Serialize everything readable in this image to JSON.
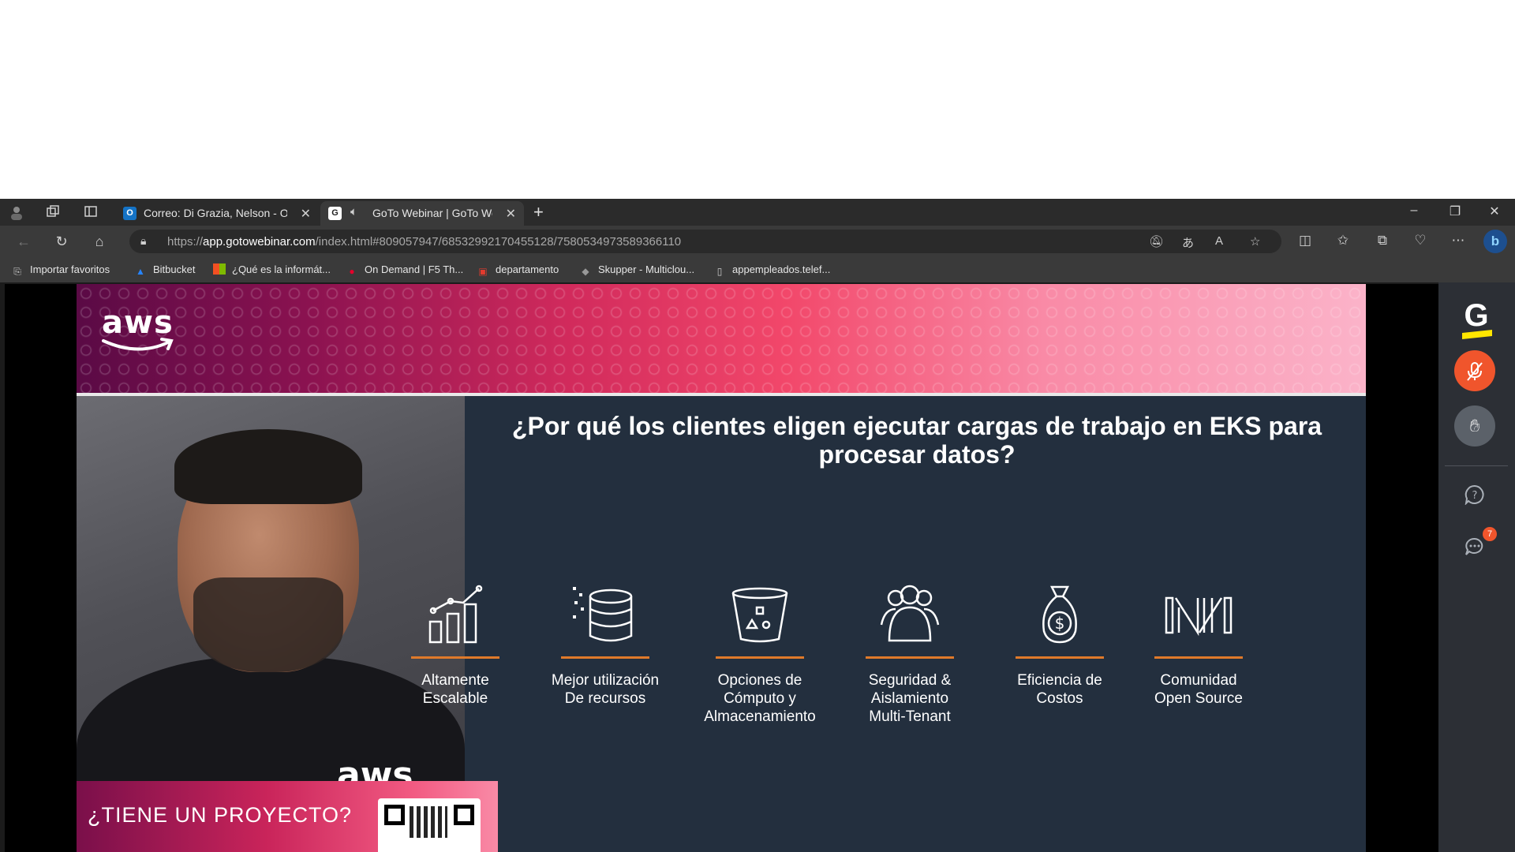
{
  "browser": {
    "tabs": [
      {
        "title": "Correo: Di Grazia, Nelson - Outlook",
        "favicon": "outlook-icon"
      },
      {
        "title": "GoTo Webinar | GoTo Webinar",
        "favicon": "goto-icon",
        "active": true,
        "audio": true
      }
    ],
    "url": {
      "scheme": "https://",
      "host": "app.gotowebinar.com",
      "path": "/index.html#809057947/6853299217045512­8/7580534973589366110"
    },
    "bookmarks": [
      {
        "label": "Importar favoritos",
        "icon": "import-icon"
      },
      {
        "label": "Bitbucket",
        "icon": "bitbucket-icon"
      },
      {
        "label": "¿Qué es la informát...",
        "icon": "microsoft-icon"
      },
      {
        "label": "On Demand | F5 Th...",
        "icon": "f5-icon"
      },
      {
        "label": "departamento",
        "icon": "pdf-icon"
      },
      {
        "label": "Skupper - Multiclou...",
        "icon": "skupper-icon"
      },
      {
        "label": "appempleados.telef...",
        "icon": "page-icon"
      }
    ]
  },
  "slide": {
    "logo": "aws",
    "title": "¿Por qué los clientes eligen ejecutar cargas de trabajo en EKS para procesar datos?",
    "features": [
      {
        "icon": "bar-chart-icon",
        "line1": "Altamente",
        "line2": "Escalable",
        "line3": ""
      },
      {
        "icon": "database-icon",
        "line1": "Mejor utilización",
        "line2": "De recursos",
        "line3": ""
      },
      {
        "icon": "bucket-shapes-icon",
        "line1": "Opciones de",
        "line2": "Cómputo y",
        "line3": "Almacenamiento"
      },
      {
        "icon": "users-icon",
        "line1": "Seguridad &",
        "line2": "Aislamiento",
        "line3": "Multi-Tenant"
      },
      {
        "icon": "money-bag-icon",
        "line1": "Eficiencia de",
        "line2": "Costos",
        "line3": ""
      },
      {
        "icon": "open-source-icon",
        "line1": "Comunidad",
        "line2": "Open Source",
        "line3": ""
      }
    ],
    "cta": "¿TIENE UN PROYECTO?",
    "presenter_shirt_logo": "aws",
    "accent_color": "#e07a2a"
  },
  "goto_panel": {
    "chat_badge": "7"
  }
}
